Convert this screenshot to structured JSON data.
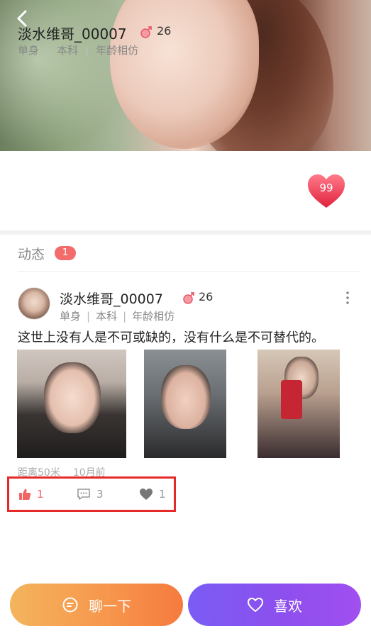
{
  "nav": {
    "back_icon": "chevron-left-icon"
  },
  "profile": {
    "name": "淡水维哥_00007",
    "gender_icon": "male-symbol-icon",
    "age": "26",
    "tags": [
      "单身",
      "本科",
      "年龄相仿"
    ],
    "like_count": "99"
  },
  "section": {
    "title": "动态",
    "badge": "1"
  },
  "post": {
    "name": "淡水维哥_00007",
    "age": "26",
    "tags": [
      "单身",
      "本科",
      "年龄相仿"
    ],
    "text": "这世上没有人是不可或缺的，没有什么是不可替代的。",
    "distance": "距离50米",
    "time": "10月前",
    "likes": "1",
    "comments": "3",
    "favorites": "1"
  },
  "buttons": {
    "chat": "聊一下",
    "like": "喜欢"
  },
  "colors": {
    "accent_red": "#f36b6b",
    "chat_orange": "#f7944c",
    "like_purple": "#8d4fee"
  }
}
